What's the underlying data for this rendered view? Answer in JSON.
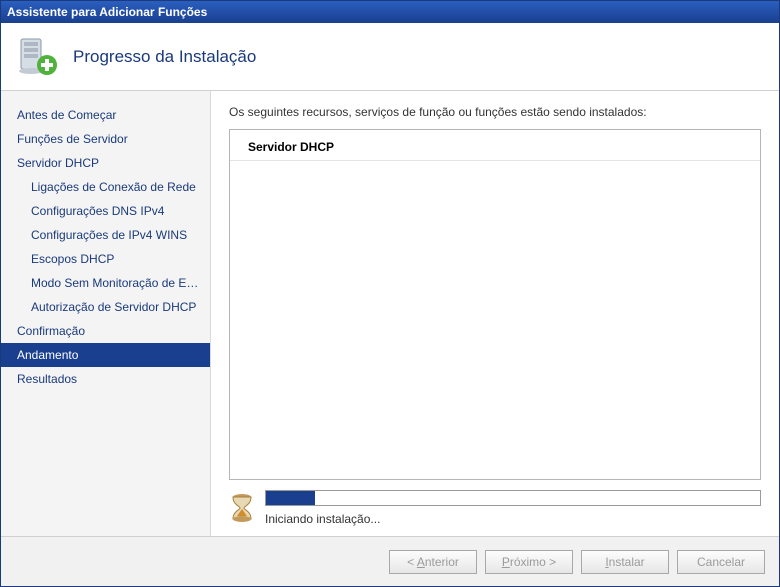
{
  "window": {
    "title": "Assistente para Adicionar Funções"
  },
  "header": {
    "title": "Progresso da Instalação"
  },
  "sidebar": {
    "items": [
      {
        "label": "Antes de Começar",
        "sub": false,
        "selected": false
      },
      {
        "label": "Funções de Servidor",
        "sub": false,
        "selected": false
      },
      {
        "label": "Servidor DHCP",
        "sub": false,
        "selected": false
      },
      {
        "label": "Ligações de Conexão de Rede",
        "sub": true,
        "selected": false
      },
      {
        "label": "Configurações DNS IPv4",
        "sub": true,
        "selected": false
      },
      {
        "label": "Configurações de IPv4 WINS",
        "sub": true,
        "selected": false
      },
      {
        "label": "Escopos DHCP",
        "sub": true,
        "selected": false
      },
      {
        "label": "Modo Sem Monitoração de Est...",
        "sub": true,
        "selected": false
      },
      {
        "label": "Autorização de Servidor DHCP",
        "sub": true,
        "selected": false
      },
      {
        "label": "Confirmação",
        "sub": false,
        "selected": false
      },
      {
        "label": "Andamento",
        "sub": false,
        "selected": true
      },
      {
        "label": "Resultados",
        "sub": false,
        "selected": false
      }
    ]
  },
  "main": {
    "intro": "Os seguintes recursos, serviços de função ou funções estão sendo instalados:",
    "list_header": "Servidor DHCP",
    "progress_label": "Iniciando instalação..."
  },
  "footer": {
    "back": "< Anterior",
    "next": "Próximo >",
    "install": "Instalar",
    "cancel": "Cancelar"
  }
}
